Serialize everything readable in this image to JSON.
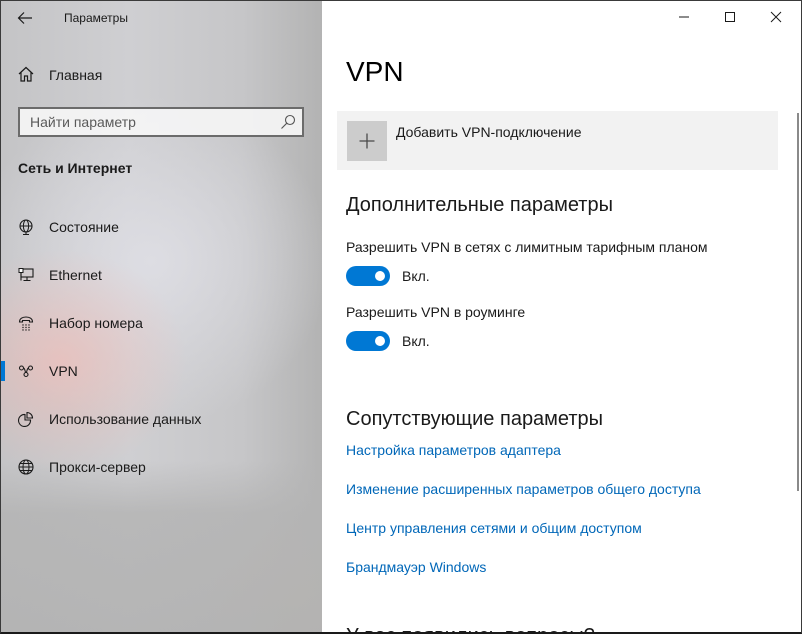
{
  "window": {
    "title": "Параметры",
    "controls": {
      "minimize": "minimize-icon",
      "maximize": "maximize-icon",
      "close": "close-icon"
    }
  },
  "sidebar": {
    "back_icon": "back-arrow-icon",
    "home": {
      "label": "Главная",
      "icon": "home-icon"
    },
    "search": {
      "placeholder": "Найти параметр",
      "value": "",
      "icon": "search-icon"
    },
    "section_title": "Сеть и Интернет",
    "items": [
      {
        "label": "Состояние",
        "icon": "network-status-icon",
        "selected": false
      },
      {
        "label": "Ethernet",
        "icon": "ethernet-icon",
        "selected": false
      },
      {
        "label": "Набор номера",
        "icon": "dial-up-icon",
        "selected": false
      },
      {
        "label": "VPN",
        "icon": "vpn-icon",
        "selected": true
      },
      {
        "label": "Использование данных",
        "icon": "data-usage-icon",
        "selected": false
      },
      {
        "label": "Прокси-сервер",
        "icon": "globe-icon",
        "selected": false
      }
    ],
    "accent_color": "#0078d4"
  },
  "main": {
    "title": "VPN",
    "add_vpn": {
      "label": "Добавить VPN-подключение",
      "icon": "plus-icon"
    },
    "advanced": {
      "heading": "Дополнительные параметры",
      "settings": [
        {
          "label": "Разрешить VPN в сетях с лимитным тарифным планом",
          "state": "Вкл.",
          "on": true
        },
        {
          "label": "Разрешить VPN в роуминге",
          "state": "Вкл.",
          "on": true
        }
      ]
    },
    "related": {
      "heading": "Сопутствующие параметры",
      "links": [
        "Настройка параметров адаптера",
        "Изменение расширенных параметров общего доступа",
        "Центр управления сетями и общим доступом",
        "Брандмауэр Windows"
      ]
    },
    "cut_off_heading": "У вас появились вопросы?",
    "link_color": "#0067b8",
    "toggle_color": "#0078d4"
  }
}
